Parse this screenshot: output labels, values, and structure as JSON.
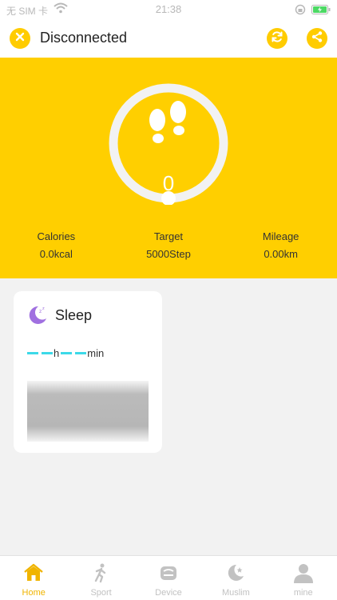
{
  "status_bar": {
    "carrier": "无 SIM 卡",
    "time": "21:38"
  },
  "header": {
    "title": "Disconnected",
    "icons": {
      "left": "close-icon",
      "refresh": "refresh-icon",
      "share": "share-icon"
    }
  },
  "steps": {
    "count": "0",
    "icon": "footprints-icon",
    "progress": 0
  },
  "stats": [
    {
      "label": "Calories",
      "value": "0.0kcal"
    },
    {
      "label": "Target",
      "value": "5000Step"
    },
    {
      "label": "Mileage",
      "value": "0.00km"
    }
  ],
  "sleep": {
    "title": "Sleep",
    "hour_unit": "h",
    "minute_unit": "min",
    "icon": "moon-icon"
  },
  "nav": [
    {
      "label": "Home",
      "icon": "home-icon",
      "active": true
    },
    {
      "label": "Sport",
      "icon": "running-person-icon",
      "active": false
    },
    {
      "label": "Device",
      "icon": "watch-device-icon",
      "active": false
    },
    {
      "label": "Muslim",
      "icon": "crescent-star-icon",
      "active": false
    },
    {
      "label": "mine",
      "icon": "person-icon",
      "active": false
    }
  ],
  "colors": {
    "accent": "#ffcf00",
    "active_nav": "#f0b400",
    "inactive_nav": "#c2c2c2",
    "sleep_dash": "#3cd9e8",
    "moon": "#a070e0"
  }
}
